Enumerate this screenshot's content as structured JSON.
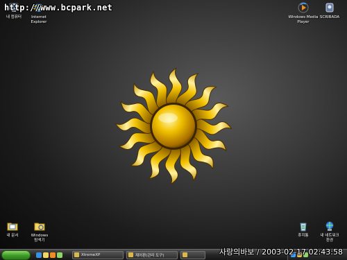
{
  "watermark": "http://www.bcpark.net",
  "datestamp": "사랑의바보 / 2003-02-17 02:43:58",
  "desktop_icons": {
    "my_computer": "내 컴퓨터",
    "internet_explorer": "Internet\nExplorer",
    "windows_media_player": "Windows Media\nPlayer",
    "scribada": "SCRIBADA",
    "my_documents": "내 문서",
    "windows_explorer": "Windows\n탐색기",
    "recycle_bin": "휴지통",
    "my_network": "내 네트워크\n환경"
  },
  "taskbar": {
    "tasks": [
      "XtremeXP",
      "제어판(관리 도구)",
      ""
    ]
  },
  "colors": {
    "sun_gold": "#f2c200",
    "sun_dark": "#8a5a00",
    "start_green": "#3d9b27"
  }
}
